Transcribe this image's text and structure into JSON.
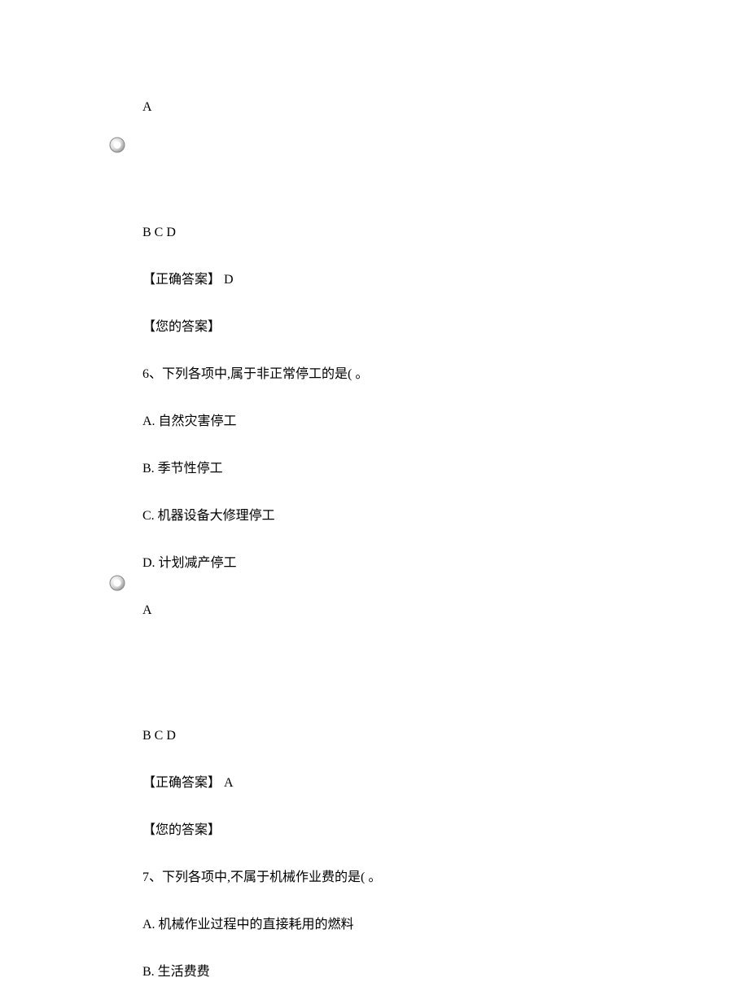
{
  "block1": {
    "letterA": "A",
    "letters": "B C D",
    "correct_label": "【正确答案】 D",
    "your_label": "【您的答案】"
  },
  "q6": {
    "stem": "6、下列各项中,属于非正常停工的是( 。",
    "optA": "A. 自然灾害停工",
    "optB": "B. 季节性停工",
    "optC": "C. 机器设备大修理停工",
    "optD": "D. 计划减产停工",
    "letterA": "A",
    "letters": "B C D",
    "correct_label": "【正确答案】 A",
    "your_label": "【您的答案】"
  },
  "q7": {
    "stem": "7、下列各项中,不属于机械作业费的是( 。",
    "optA": "A. 机械作业过程中的直接耗用的燃料",
    "optB": "B. 生活费费"
  }
}
